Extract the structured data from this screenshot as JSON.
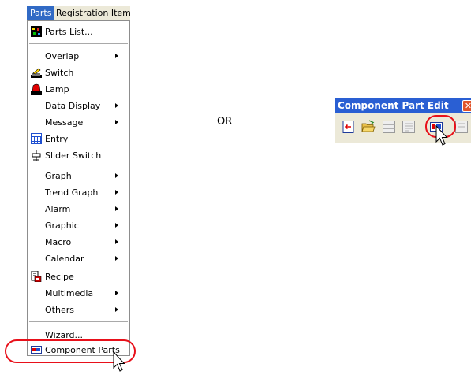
{
  "menubar": {
    "items": [
      {
        "label": "Parts",
        "active": true
      },
      {
        "label": "Registration Item",
        "active": false
      }
    ]
  },
  "parts_menu": {
    "items": [
      {
        "label": "Parts List...",
        "icon": "parts-list-icon",
        "submenu": false
      },
      {
        "label": "Overlap",
        "submenu": true
      },
      {
        "label": "Switch",
        "icon": "switch-icon",
        "submenu": false
      },
      {
        "label": "Lamp",
        "icon": "lamp-icon",
        "submenu": false
      },
      {
        "label": "Data Display",
        "submenu": true
      },
      {
        "label": "Message",
        "submenu": true
      },
      {
        "label": "Entry",
        "icon": "entry-icon",
        "submenu": false
      },
      {
        "label": "Slider Switch",
        "icon": "slider-switch-icon",
        "submenu": false
      },
      {
        "label": "Graph",
        "submenu": true
      },
      {
        "label": "Trend Graph",
        "submenu": true
      },
      {
        "label": "Alarm",
        "submenu": true
      },
      {
        "label": "Graphic",
        "submenu": true
      },
      {
        "label": "Macro",
        "submenu": true
      },
      {
        "label": "Calendar",
        "submenu": true
      },
      {
        "label": "Recipe",
        "icon": "recipe-icon",
        "submenu": false
      },
      {
        "label": "Multimedia",
        "submenu": true
      },
      {
        "label": "Others",
        "submenu": true
      },
      {
        "label": "Wizard...",
        "submenu": false
      },
      {
        "label": "Component Parts",
        "icon": "component-parts-icon",
        "submenu": false
      }
    ]
  },
  "or_text": "OR",
  "toolbar": {
    "title": "Component Part Edit",
    "close_glyph": "✕",
    "buttons": [
      {
        "icon": "import-icon"
      },
      {
        "icon": "open-folder-icon"
      },
      {
        "icon": "grid-icon"
      },
      {
        "icon": "list-icon"
      },
      {
        "icon": "component-parts-icon"
      },
      {
        "icon": "partial-icon"
      }
    ]
  },
  "colors": {
    "highlight_oval": "#e8101a",
    "menu_selection": "#316ac5",
    "title_bar": "#2a5fd3"
  }
}
